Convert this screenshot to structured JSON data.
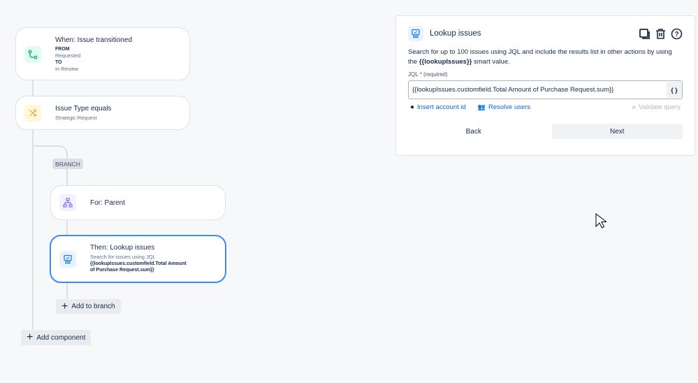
{
  "flow": {
    "trigger": {
      "title": "When: Issue transitioned",
      "from_label": "FROM",
      "from_value": "Requested",
      "to_label": "TO",
      "to_value": "In Review"
    },
    "condition": {
      "title": "Issue Type equals",
      "value": "Strategic Request"
    },
    "branch_label": "BRANCH",
    "branch_rule": {
      "title": "For: Parent"
    },
    "action": {
      "title": "Then: Lookup issues",
      "desc": "Search for issues using JQL",
      "jql": "{{lookupIssues.customfield.Total Amount of Purchase Request.sum}}"
    },
    "add_to_branch": "Add to branch",
    "add_component": "Add component"
  },
  "panel": {
    "title": "Lookup issues",
    "desc_pre": "Search for up to 100 issues using JQL and include the results list in other actions by using the ",
    "desc_bold": "{{lookupIssues}}",
    "desc_post": " smart value.",
    "field_label": "JQL",
    "required_mark": "*",
    "required_text": "(required)",
    "jql_value": "{{lookupIssues.customfield.Total Amount of Purchase Request.sum}}",
    "smart_value_btn": "{ }",
    "insert_account": "Insert account id",
    "resolve_users": "Resolve users",
    "validate": "Validate query",
    "back": "Back",
    "next": "Next"
  }
}
